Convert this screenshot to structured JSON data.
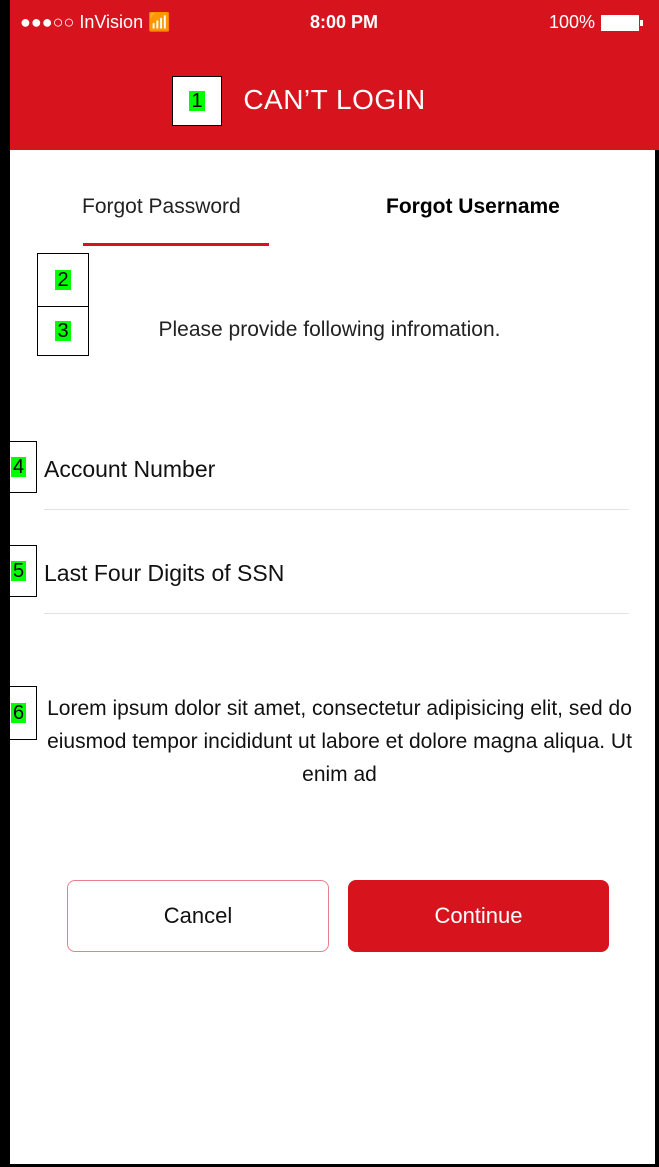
{
  "status_bar": {
    "carrier": "●●●○○ InVision",
    "wifi_icon": "wifi-icon",
    "time": "8:00 PM",
    "battery_text": "100%"
  },
  "header": {
    "title": "CAN’T LOGIN"
  },
  "annotations": {
    "l1": "1",
    "l2": "2",
    "l3": "3",
    "l4": "4",
    "l5": "5",
    "l6": "6"
  },
  "tabs": {
    "forgot_password": "Forgot Password",
    "forgot_username": "Forgot Username"
  },
  "instruction": "Please provide following infromation.",
  "fields": {
    "account_number_placeholder": "Account Number",
    "ssn_placeholder": "Last Four Digits of SSN"
  },
  "body_text": "Lorem ipsum dolor sit amet, consectetur adipisicing elit, sed do eiusmod tempor incididunt ut labore et dolore magna aliqua. Ut enim ad",
  "buttons": {
    "cancel": "Cancel",
    "continue": "Continue"
  },
  "colors": {
    "accent": "#d7141d",
    "cancel_border": "#e8808a"
  }
}
